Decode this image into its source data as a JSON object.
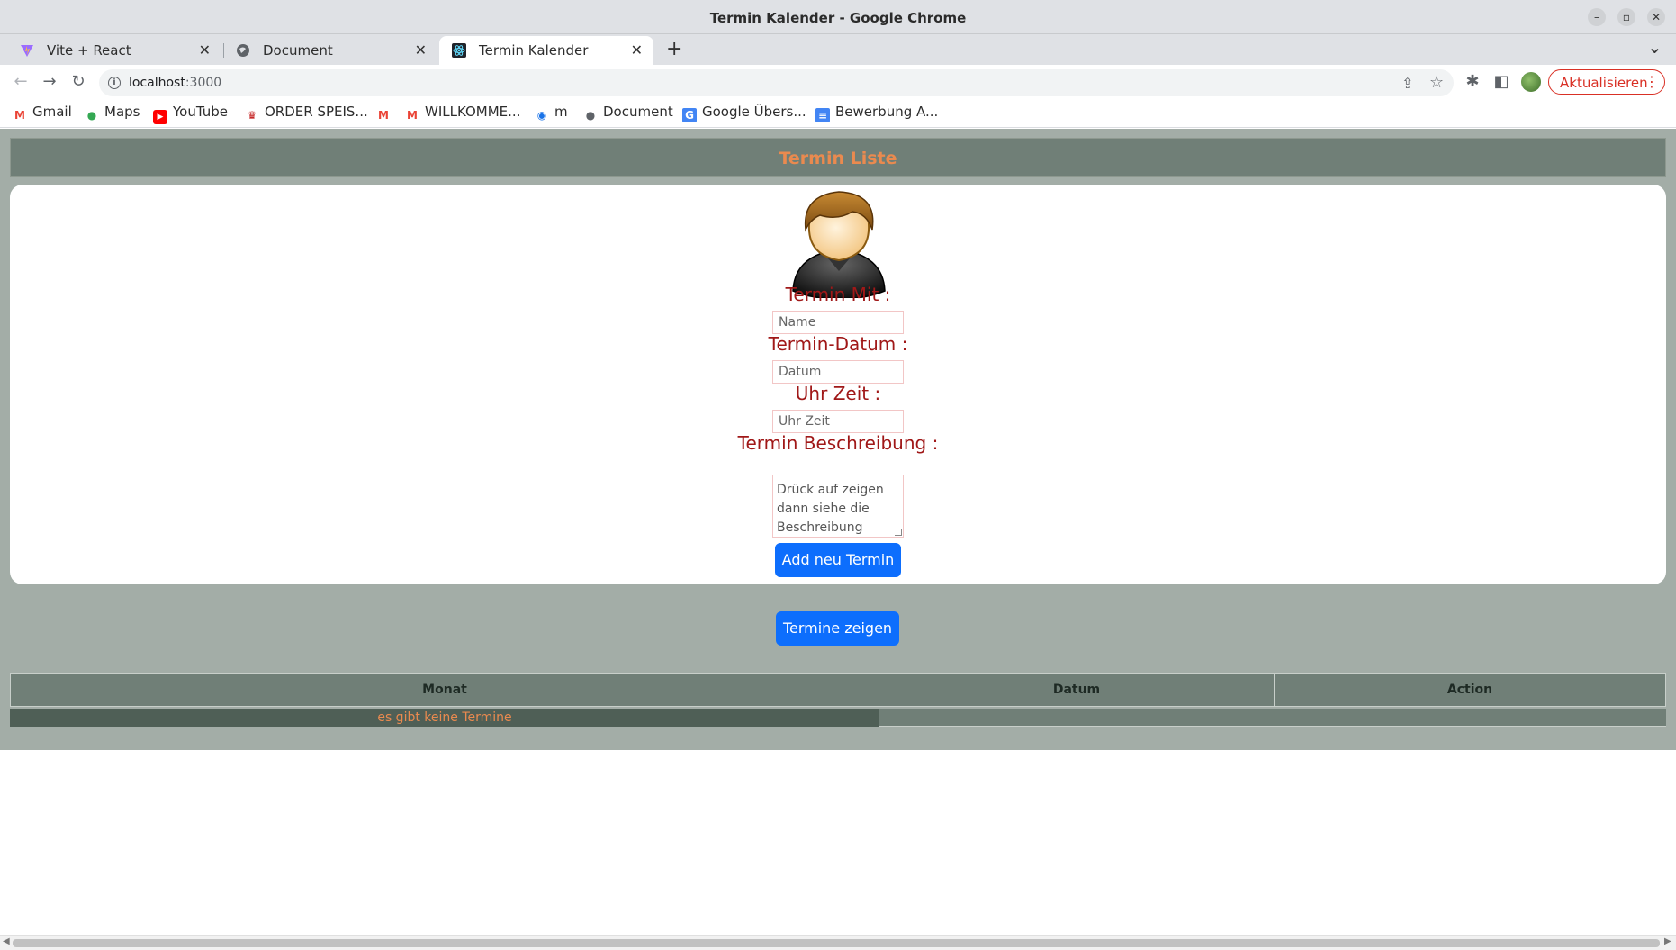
{
  "window": {
    "title": "Termin Kalender - Google Chrome",
    "controls": {
      "minimize": "–",
      "restore": "▫",
      "close": "✕"
    }
  },
  "tabs": [
    {
      "label": "Vite + React",
      "icon": "vite-icon",
      "close": "✕"
    },
    {
      "label": "Document",
      "icon": "globe-icon",
      "close": "✕"
    },
    {
      "label": "Termin Kalender",
      "icon": "react-icon",
      "close": "✕",
      "active": true
    }
  ],
  "tabstrip": {
    "new_tab": "+",
    "tab_search": "⌄"
  },
  "toolbar": {
    "back": "←",
    "forward": "→",
    "reload": "↻",
    "url_host": "localhost",
    "url_port": ":3000",
    "share": "⇪",
    "star": "☆",
    "extensions": "✱",
    "sidepanel": "◧",
    "update_label": "Aktualisieren",
    "menu": "⋮"
  },
  "bookmarks": [
    {
      "label": "Gmail",
      "icon": "gmail-icon",
      "glyph": "M",
      "color": "#ea4335"
    },
    {
      "label": "Maps",
      "icon": "maps-icon",
      "glyph": "●",
      "color": "#34a853"
    },
    {
      "label": "YouTube",
      "icon": "youtube-icon",
      "glyph": "▶",
      "color": "#ff0000"
    },
    {
      "label": "ORDER SPEIS...",
      "icon": "order-icon",
      "glyph": "♛",
      "color": "#c62828"
    },
    {
      "label": "",
      "icon": "gmail-icon",
      "glyph": "M",
      "color": "#ea4335"
    },
    {
      "label": "WILLKOMME...",
      "icon": "gmail-icon",
      "glyph": "M",
      "color": "#ea4335"
    },
    {
      "label": "m",
      "icon": "m-icon",
      "glyph": "◉",
      "color": "#1a73e8"
    },
    {
      "label": "Document",
      "icon": "globe-icon",
      "glyph": "●",
      "color": "#5f6368"
    },
    {
      "label": "Google Übers...",
      "icon": "translate-icon",
      "glyph": "G",
      "color": "#4285f4"
    },
    {
      "label": "Bewerbung A...",
      "icon": "docs-icon",
      "glyph": "≡",
      "color": "#4285f4"
    }
  ],
  "page": {
    "header": "Termin Liste",
    "form": {
      "name_label": "Termin Mit :",
      "name_placeholder": "Name",
      "date_label": "Termin-Datum :",
      "date_placeholder": "Datum",
      "time_label": "Uhr Zeit :",
      "time_placeholder": "Uhr Zeit",
      "desc_label": "Termin Beschreibung :",
      "desc_placeholder": "Drück auf zeigen\ndann siehe die\nBeschreibung",
      "submit": "Add neu Termin"
    },
    "show_button": "Termine zeigen",
    "table": {
      "columns": [
        "Monat",
        "Datum",
        "Action"
      ],
      "empty_message": "es gibt keine Termine"
    }
  },
  "colors": {
    "accent_orange": "#ea8a4f",
    "label_red": "#a01818",
    "primary_blue": "#0d6efd",
    "header_green": "#707f77",
    "page_bg": "#a3ada7"
  }
}
